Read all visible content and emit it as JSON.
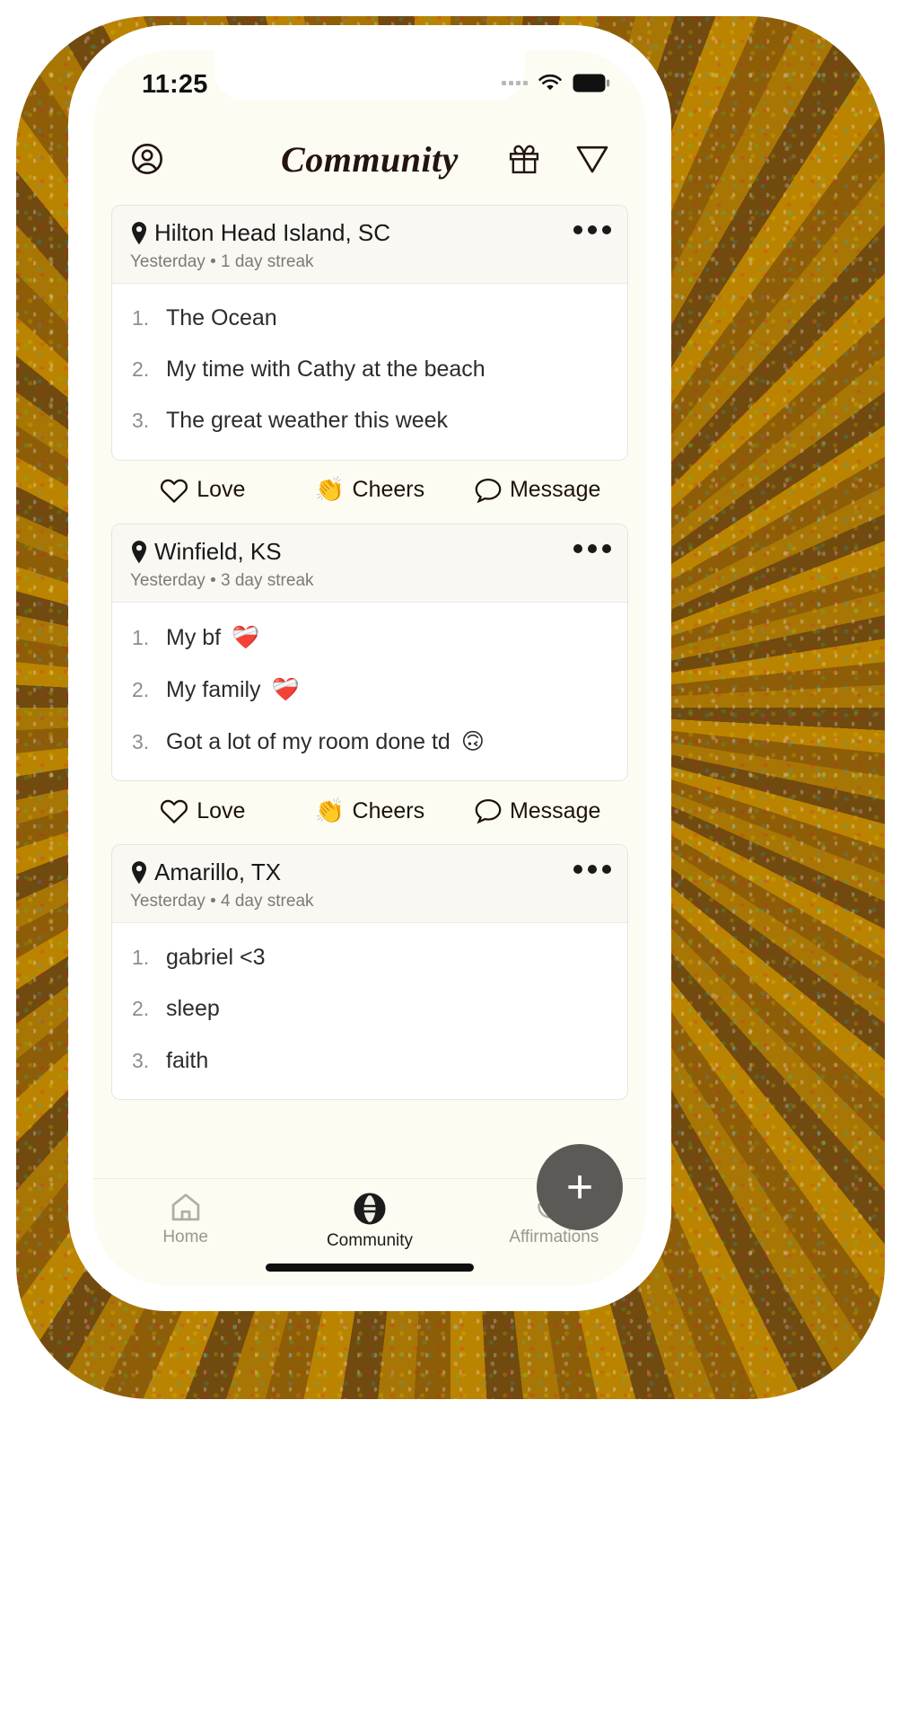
{
  "status_bar": {
    "time": "11:25",
    "signal_icon": "cellular-dots-icon",
    "wifi_icon": "wifi-icon",
    "battery_icon": "battery-full-icon"
  },
  "header": {
    "title": "Community",
    "profile_icon": "profile-circle-icon",
    "gift_icon": "gift-icon",
    "send_icon": "send-paper-plane-icon"
  },
  "posts": [
    {
      "location": "Hilton Head Island, SC",
      "meta": "Yesterday • 1 day streak",
      "menu_icon": "more-options-icon",
      "items": [
        {
          "num": "1.",
          "text": "The Ocean"
        },
        {
          "num": "2.",
          "text": "My time with Cathy at the beach"
        },
        {
          "num": "3.",
          "text": "The great weather this week"
        }
      ],
      "actions": [
        {
          "icon": "heart-outline-icon",
          "label": "Love"
        },
        {
          "icon": "clapping-hands-icon",
          "label": "Cheers"
        },
        {
          "icon": "speech-bubble-icon",
          "label": "Message"
        }
      ]
    },
    {
      "location": "Winfield, KS",
      "meta": "Yesterday • 3 day streak",
      "menu_icon": "more-options-icon",
      "items": [
        {
          "num": "1.",
          "text": "My bf",
          "emoji": "❤️‍🩹"
        },
        {
          "num": "2.",
          "text": "My family",
          "emoji": "❤️‍🩹"
        },
        {
          "num": "3.",
          "text": "Got a lot of my room done td",
          "emoji": "🙃"
        }
      ],
      "actions": [
        {
          "icon": "heart-outline-icon",
          "label": "Love"
        },
        {
          "icon": "clapping-hands-icon",
          "label": "Cheers"
        },
        {
          "icon": "speech-bubble-icon",
          "label": "Message"
        }
      ]
    },
    {
      "location": "Amarillo, TX",
      "meta": "Yesterday • 4 day streak",
      "menu_icon": "more-options-icon",
      "items": [
        {
          "num": "1.",
          "text": "gabriel <3"
        },
        {
          "num": "2.",
          "text": "sleep"
        },
        {
          "num": "3.",
          "text": "faith"
        }
      ],
      "actions": []
    }
  ],
  "fab": {
    "label": "+",
    "icon": "plus-icon",
    "background": "#5c5a57"
  },
  "tabbar": {
    "tabs": [
      {
        "label": "Home",
        "icon": "house-icon",
        "active": false
      },
      {
        "label": "Community",
        "icon": "globe-icon",
        "active": true
      },
      {
        "label": "Affirmations",
        "icon": "lotus-icon",
        "active": false
      }
    ]
  },
  "colors": {
    "screen_bg": "#fdfcf3",
    "card_head_bg": "#faf8f3",
    "card_body_bg": "#ffffff",
    "text_primary": "#231410",
    "text_muted": "#7b7b7b",
    "frame": "#8a5d10"
  }
}
